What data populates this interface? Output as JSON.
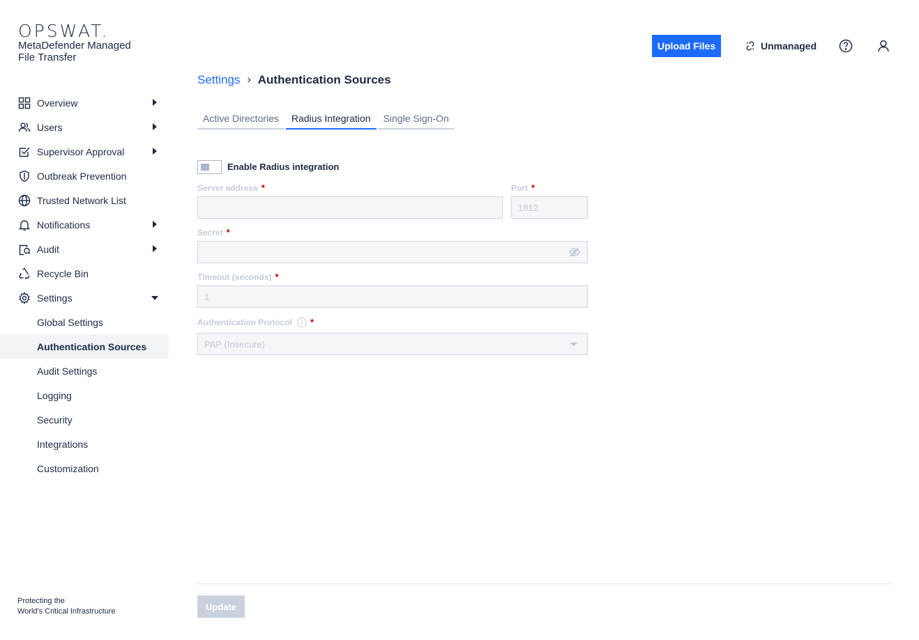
{
  "brand": {
    "logo_text": "OPSWAT.",
    "product_name": "MetaDefender Managed File Transfer",
    "tagline_line1": "Protecting the",
    "tagline_line2": "World's Critical Infrastructure"
  },
  "header": {
    "upload_label": "Upload Files",
    "status_label": "Unmanaged",
    "help_icon": "help-circle-icon",
    "user_icon": "user-icon"
  },
  "sidebar": {
    "items": [
      {
        "label": "Overview",
        "icon": "grid-icon",
        "expandable": true
      },
      {
        "label": "Users",
        "icon": "users-icon",
        "expandable": true
      },
      {
        "label": "Supervisor Approval",
        "icon": "checkbox-icon",
        "expandable": true
      },
      {
        "label": "Outbreak Prevention",
        "icon": "shield-icon",
        "expandable": false
      },
      {
        "label": "Trusted Network List",
        "icon": "globe-icon",
        "expandable": false
      },
      {
        "label": "Notifications",
        "icon": "bell-icon",
        "expandable": true
      },
      {
        "label": "Audit",
        "icon": "audit-icon",
        "expandable": true
      },
      {
        "label": "Recycle Bin",
        "icon": "recycle-icon",
        "expandable": false
      },
      {
        "label": "Settings",
        "icon": "gear-icon",
        "expandable": true,
        "expanded": true
      }
    ],
    "settings_children": [
      {
        "label": "Global Settings"
      },
      {
        "label": "Authentication Sources",
        "active": true
      },
      {
        "label": "Audit Settings"
      },
      {
        "label": "Logging"
      },
      {
        "label": "Security"
      },
      {
        "label": "Integrations"
      },
      {
        "label": "Customization"
      }
    ]
  },
  "breadcrumb": {
    "parent": "Settings",
    "separator": "›",
    "current": "Authentication Sources"
  },
  "tabs": [
    {
      "label": "Active Directories",
      "active": false
    },
    {
      "label": "Radius Integration",
      "active": true
    },
    {
      "label": "Single Sign-On",
      "active": false
    }
  ],
  "form": {
    "enable_label": "Enable Radius integration",
    "enabled": false,
    "server_address": {
      "label": "Server address",
      "required_mark": "*",
      "value": ""
    },
    "port": {
      "label": "Port",
      "required_mark": "*",
      "placeholder": "1812"
    },
    "secret": {
      "label": "Secret",
      "required_mark": "*",
      "value": ""
    },
    "timeout": {
      "label": "Timeout (seconds)",
      "required_mark": "*",
      "value": "1"
    },
    "auth_protocol": {
      "label": "Authentication Protocol",
      "required_mark": "*",
      "info_glyph": "i",
      "selected": "PAP (Insecure)"
    },
    "update_label": "Update"
  },
  "colors": {
    "accent": "#1d6bfc",
    "text": "#1d2a44",
    "required": "#c00000",
    "disabled": "#c9d1de"
  }
}
